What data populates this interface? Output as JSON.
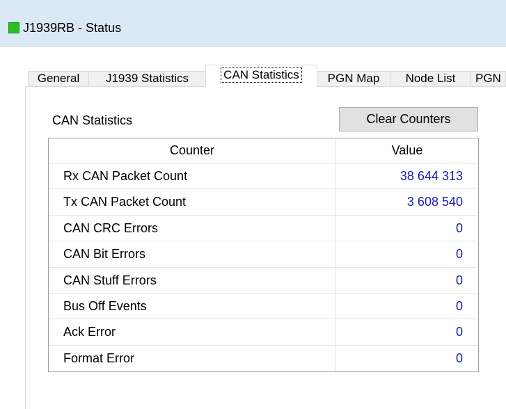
{
  "window": {
    "title": "J1939RB - Status",
    "status_color": "#27c021"
  },
  "tabs": [
    {
      "label": "General",
      "active": false
    },
    {
      "label": "J1939 Statistics",
      "active": false
    },
    {
      "label": "CAN Statistics",
      "active": true
    },
    {
      "label": "PGN Map",
      "active": false
    },
    {
      "label": "Node List",
      "active": false
    },
    {
      "label": "PGN",
      "active": false
    }
  ],
  "panel": {
    "section_label": "CAN Statistics",
    "clear_button_label": "Clear Counters"
  },
  "table": {
    "columns": [
      "Counter",
      "Value"
    ],
    "rows": [
      {
        "counter": "Rx CAN Packet Count",
        "value": "38 644 313"
      },
      {
        "counter": "Tx CAN Packet Count",
        "value": "3 608 540"
      },
      {
        "counter": "CAN CRC Errors",
        "value": "0"
      },
      {
        "counter": "CAN Bit Errors",
        "value": "0"
      },
      {
        "counter": "CAN Stuff Errors",
        "value": "0"
      },
      {
        "counter": "Bus Off Events",
        "value": "0"
      },
      {
        "counter": "Ack Error",
        "value": "0"
      },
      {
        "counter": "Format Error",
        "value": "0"
      }
    ]
  },
  "colors": {
    "title_bar": "#dbe8f6",
    "value_text": "#1a1ab8"
  }
}
